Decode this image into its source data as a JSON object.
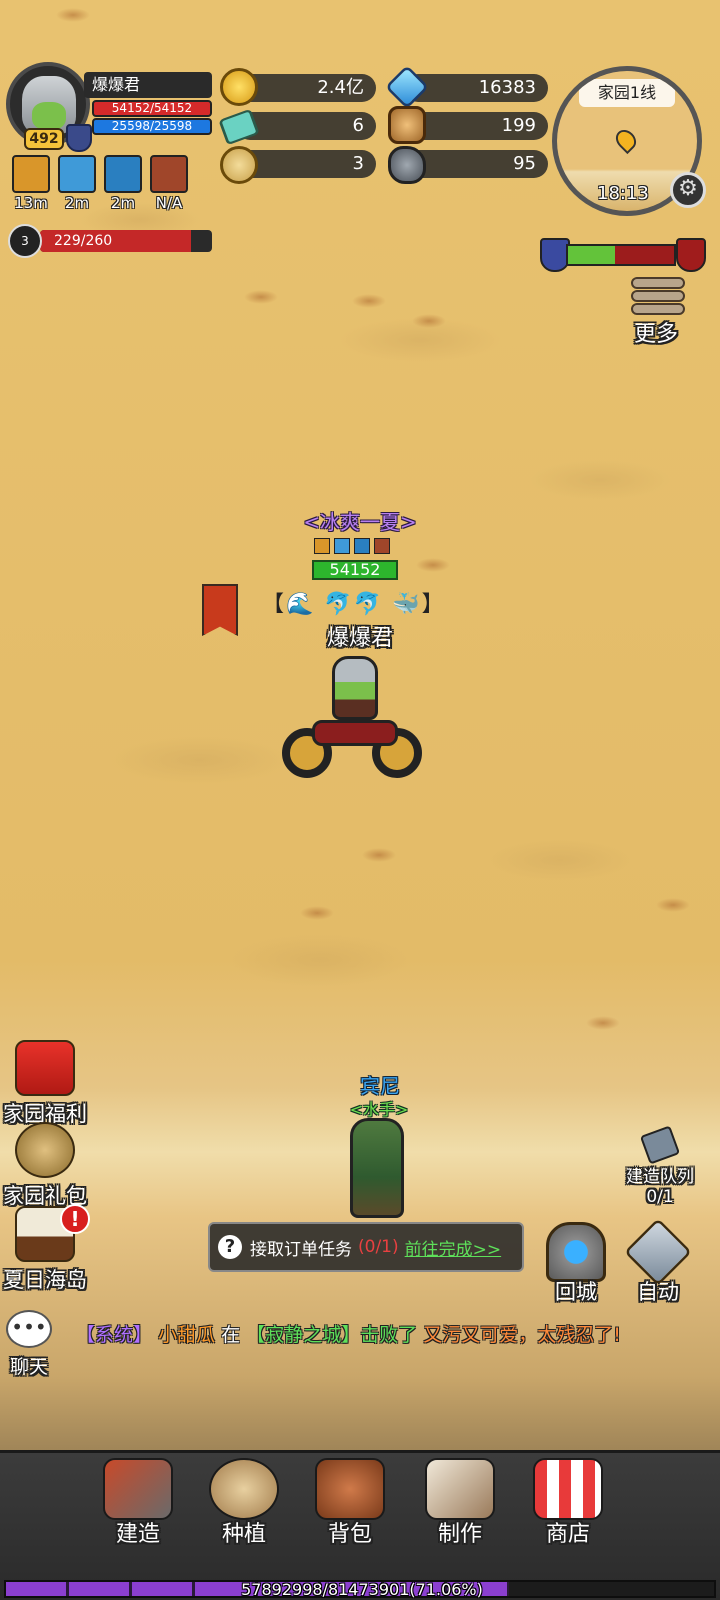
{
  "player": {
    "name": "爆爆君",
    "level": "492",
    "hp": "54152/54152",
    "mp": "25598/25598",
    "stamina": "229/260",
    "stamina_fraction": 0.88,
    "stamina_level": "3"
  },
  "buffs": [
    {
      "icon": "crown-buff-icon",
      "label": "13m",
      "color": "#d9962a"
    },
    {
      "icon": "crystal-buff-icon",
      "label": "2m",
      "color": "#3f9ad8"
    },
    {
      "icon": "wave-buff-icon",
      "label": "2m",
      "color": "#2a7fc0"
    },
    {
      "icon": "horse-buff-icon",
      "label": "N/A",
      "color": "#a0462a"
    }
  ],
  "resources": {
    "gold": "2.4亿",
    "diamond": "16383",
    "ticket": "6",
    "wood": "199",
    "medal": "3",
    "ore": "95"
  },
  "minimap": {
    "title": "家园1线",
    "time": "18:13"
  },
  "faction": {
    "left_fraction": 0.44,
    "left_color": "#63c33a",
    "right_color": "#9c1c1c"
  },
  "more_label": "更多",
  "character": {
    "guild_title": "<冰爽一夏>",
    "hp_value": "54152",
    "name": "爆爆君",
    "pets_open": "【",
    "pets_close": "】"
  },
  "npc": {
    "name": "宾尼",
    "title": "<水手>"
  },
  "side_buttons": [
    {
      "label": "家园福利"
    },
    {
      "label": "家园礼包"
    },
    {
      "label": "夏日海岛"
    }
  ],
  "alert_mark": "!",
  "quest": {
    "text": "接取订单任务",
    "count": "(0/1)",
    "go": "前往完成>>"
  },
  "build_queue": {
    "label": "建造队列",
    "count": "0/1"
  },
  "right_buttons": {
    "return": "回城",
    "auto": "自动"
  },
  "chat": {
    "label": "聊天",
    "system": "【系统】",
    "user": "小甜瓜",
    "in": "在",
    "place": "【寂静之城】",
    "verb": "击败了",
    "target": "又污又可爱，太残忍了!"
  },
  "nav": [
    {
      "label": "建造"
    },
    {
      "label": "种植"
    },
    {
      "label": "背包"
    },
    {
      "label": "制作"
    },
    {
      "label": "商店"
    }
  ],
  "xp": {
    "text": "57892998/81473901(71.06%)",
    "fraction": 0.7106
  }
}
